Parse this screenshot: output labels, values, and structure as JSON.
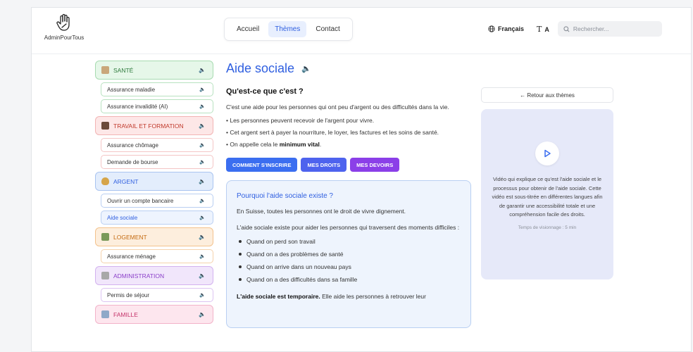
{
  "header": {
    "logo_text": "AdminPourTous",
    "nav": [
      {
        "label": "Accueil",
        "active": false
      },
      {
        "label": "Thèmes",
        "active": true
      },
      {
        "label": "Contact",
        "active": false
      }
    ],
    "language": "Français",
    "text_size_t": "T",
    "text_size_a": "A",
    "search_placeholder": "Rechercher..."
  },
  "sidebar": {
    "categories": [
      {
        "label": "SANTÉ",
        "color": "green",
        "items": [
          "Assurance maladie",
          "Assurance invalidité (AI)"
        ]
      },
      {
        "label": "TRAVAIL ET FORMATION",
        "color": "red",
        "items": [
          "Assurance chômage",
          "Demande de bourse"
        ]
      },
      {
        "label": "ARGENT",
        "color": "blue",
        "items": [
          "Ouvrir un compte bancaire",
          "Aide sociale"
        ],
        "active_item": "Aide sociale"
      },
      {
        "label": "LOGEMENT",
        "color": "orange",
        "items": [
          "Assurance ménage"
        ]
      },
      {
        "label": "ADMINISTRATION",
        "color": "purple",
        "items": [
          "Permis de séjour"
        ]
      },
      {
        "label": "FAMILLE",
        "color": "pink",
        "items": []
      }
    ],
    "speaker_glyph": "🔈"
  },
  "main": {
    "title": "Aide sociale",
    "section_title": "Qu'est-ce que c'est ?",
    "intro": "C'est une aide pour les personnes qui ont peu d'argent ou des difficultés dans la vie.",
    "bullets": [
      "• Les personnes peuvent recevoir de l'argent pour vivre.",
      "• Cet argent sert à payer la nourriture, le loyer, les factures et les soins de santé."
    ],
    "bullet_last_prefix": "• On appelle cela le ",
    "bullet_last_bold": "minimum vital",
    "bullet_last_suffix": ".",
    "buttons": [
      "COMMENT S'INSCRIRE",
      "MES DROITS",
      "MES DEVOIRS"
    ],
    "card": {
      "title": "Pourquoi l'aide sociale existe ?",
      "p1": "En Suisse, toutes les personnes ont le droit de vivre dignement.",
      "p2": "L'aide sociale existe pour aider les personnes qui traversent des moments difficiles :",
      "list": [
        "Quand on perd son travail",
        "Quand on a des problèmes de santé",
        "Quand on arrive dans un nouveau pays",
        "Quand on a des difficultés dans sa famille"
      ],
      "last_bold": "L'aide sociale est temporaire.",
      "last_rest": " Elle aide les personnes à retrouver leur"
    }
  },
  "aside": {
    "back_label": "← Retour aux thèmes",
    "video_description": "Vidéo qui explique ce qu'est l'aide sociale et le processus pour obtenir de l'aide sociale. Cette vidéo est sous-titrée en différentes langues afin de garantir une accessibilité totale et une compréhension facile des droits.",
    "video_time": "Temps de visionnage : 5 min"
  }
}
